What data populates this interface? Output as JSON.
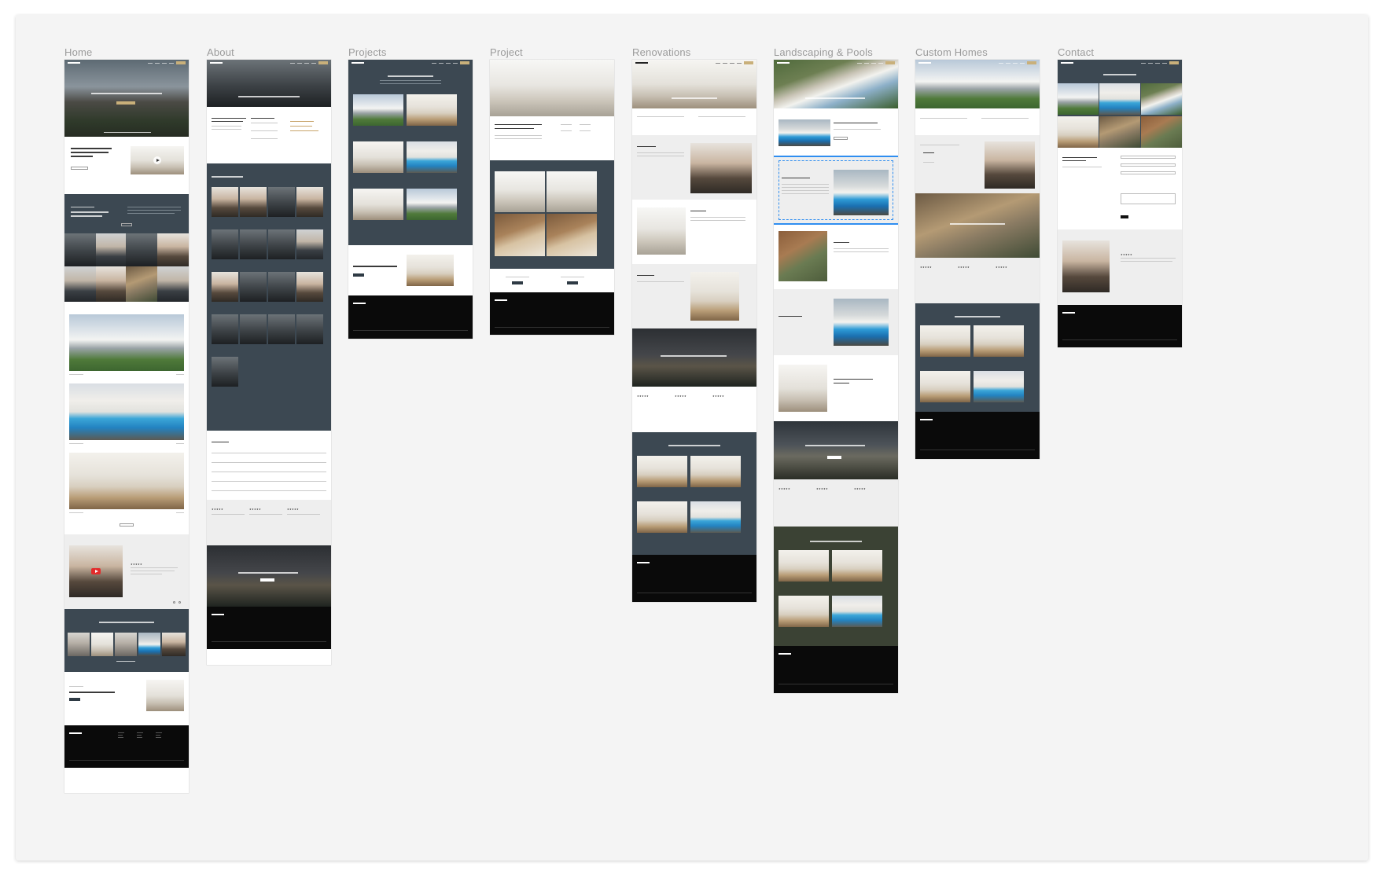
{
  "frames": [
    {
      "id": "home",
      "label": "Home"
    },
    {
      "id": "about",
      "label": "About"
    },
    {
      "id": "projects",
      "label": "Projects"
    },
    {
      "id": "project",
      "label": "Project"
    },
    {
      "id": "renovations",
      "label": "Renovations"
    },
    {
      "id": "landscaping",
      "label": "Landscaping & Pools"
    },
    {
      "id": "custom",
      "label": "Custom Homes"
    },
    {
      "id": "contact",
      "label": "Contact"
    }
  ],
  "colors": {
    "canvas": "#f4f4f4",
    "dark_section": "#3c4852",
    "footer": "#0a0a0a",
    "olive_section": "#3b4234",
    "accent_gold": "#c9b07a",
    "selection_blue": "#2f8ef0"
  },
  "selected_element": "landscaping-design-build-section",
  "icons": [
    "play-icon",
    "youtube-icon",
    "star-icon",
    "chevron-left-icon",
    "chevron-right-icon"
  ]
}
